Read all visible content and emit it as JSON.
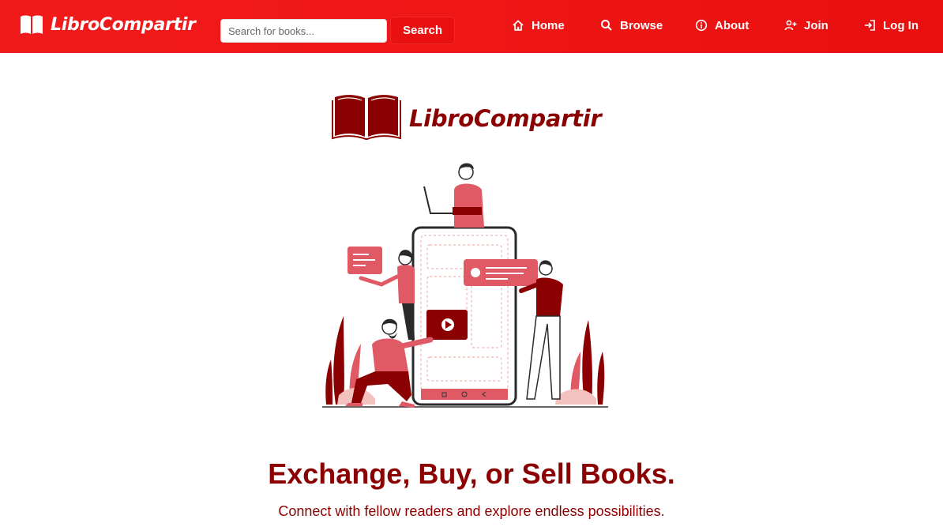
{
  "brand": {
    "name": "LibroCompartir",
    "icon": "open-book-icon"
  },
  "search": {
    "placeholder": "Search for books...",
    "value": "",
    "button_label": "Search"
  },
  "nav": {
    "items": [
      {
        "label": "Home",
        "icon": "home-icon"
      },
      {
        "label": "Browse",
        "icon": "search-icon"
      },
      {
        "label": "About",
        "icon": "info-icon"
      },
      {
        "label": "Join",
        "icon": "user-plus-icon"
      },
      {
        "label": "Log In",
        "icon": "login-icon"
      }
    ]
  },
  "hero": {
    "logo_text": "LibroCompartir",
    "headline": "Exchange, Buy, or Sell Books.",
    "subline": "Connect with fellow readers and explore endless possibilities."
  },
  "colors": {
    "nav_bg": "#ef1616",
    "accent_dark": "#8b0000",
    "accent_light": "#e05a66"
  }
}
